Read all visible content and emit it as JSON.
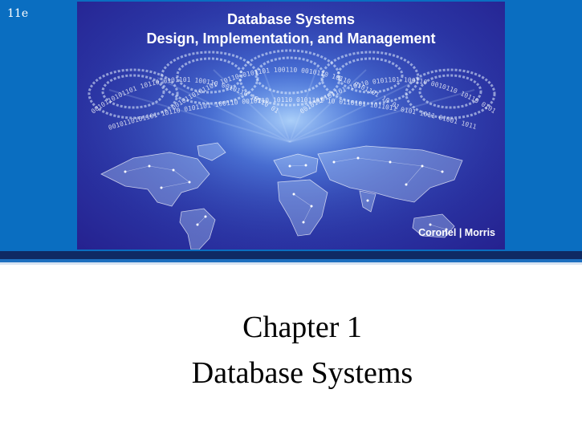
{
  "edition": "11e",
  "cover": {
    "title_line1": "Database Systems",
    "title_line2": "Design, Implementation, and Management",
    "authors": "Coronel | Morris",
    "binary_text": "0010110101101 10110 0101101 100110 0010110 10110 0101101 10 0110101 1011011 0101 1011 01001 1011 110010 1011 0101",
    "colors": {
      "band": "#0a6ec1",
      "cover_dark": "#25218f",
      "cover_light": "#3a61d6",
      "stripe_dark": "#0f2a63"
    }
  },
  "slide": {
    "chapter": "Chapter 1",
    "subtitle": "Database Systems"
  }
}
